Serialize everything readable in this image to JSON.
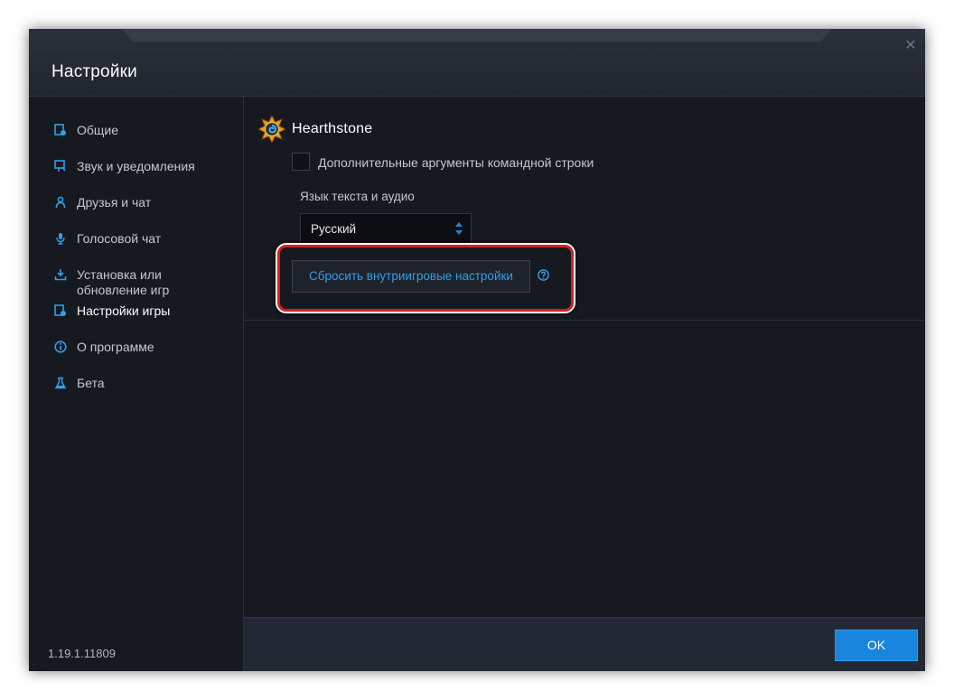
{
  "window": {
    "title": "Настройки",
    "close_glyph": "✕"
  },
  "sidebar": {
    "items": [
      {
        "label": "Общие",
        "icon": "general-settings-icon"
      },
      {
        "label": "Звук и уведомления",
        "icon": "sound-notifications-icon"
      },
      {
        "label": "Друзья и чат",
        "icon": "friends-chat-icon"
      },
      {
        "label": "Голосовой чат",
        "icon": "microphone-icon"
      },
      {
        "label": "Установка или обновление игр",
        "icon": "install-update-icon"
      },
      {
        "label": "Настройки игры",
        "icon": "game-settings-icon",
        "active": true
      },
      {
        "label": "О программе",
        "icon": "info-icon"
      },
      {
        "label": "Бета",
        "icon": "beta-flask-icon"
      }
    ],
    "version": "1.19.1.11809"
  },
  "game": {
    "name": "Hearthstone",
    "icon": "hearthstone-logo-icon",
    "cmd_args_label": "Дополнительные аргументы командной строки",
    "cmd_args_checked": false,
    "language_label": "Язык текста и аудио",
    "language_value": "Русский",
    "reset_button_label": "Сбросить внутриигровые настройки",
    "help_icon": "help-question-icon"
  },
  "footer": {
    "ok_label": "OK"
  },
  "colors": {
    "accent": "#1786dc",
    "link": "#2f9fe8",
    "highlight": "#d42121",
    "background": "#161920"
  }
}
